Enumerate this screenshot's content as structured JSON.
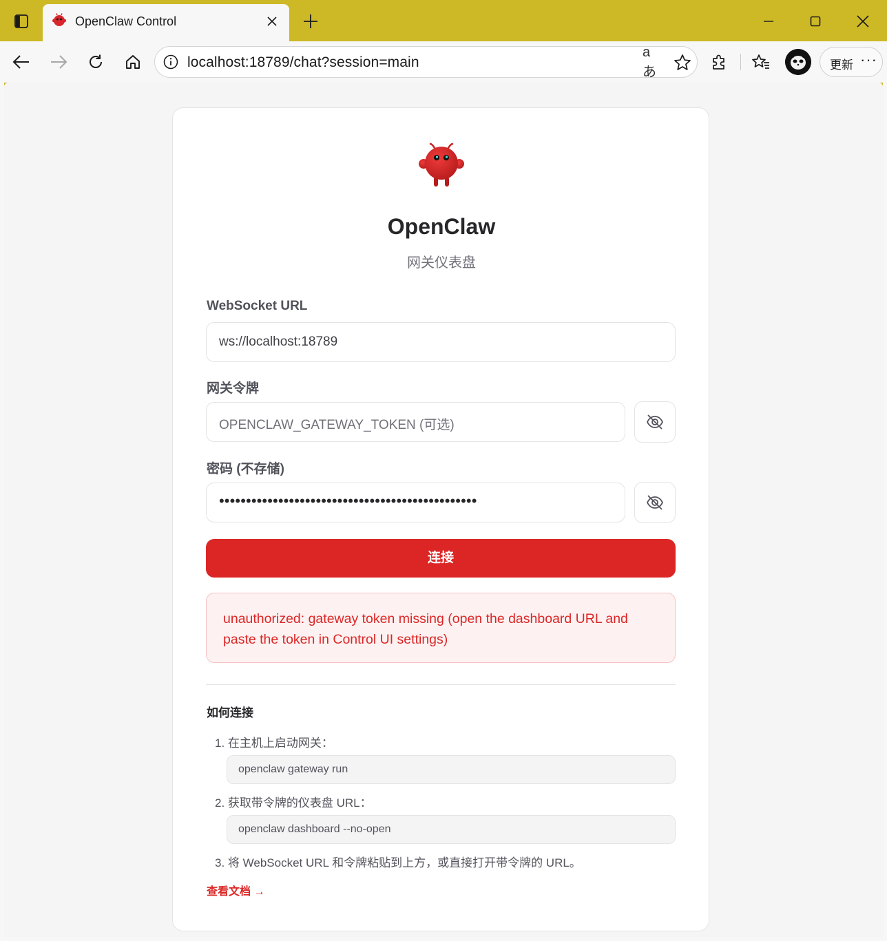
{
  "browser": {
    "tab": {
      "title": "OpenClaw Control",
      "favicon": "openclaw-mascot-icon"
    },
    "address_bar": {
      "url": "localhost:18789/chat?session=main",
      "read_aloud_glyph": "aあ"
    },
    "update_button": {
      "label": "更新",
      "more": "···"
    },
    "accent_color": "#cdb826"
  },
  "app": {
    "brand": "OpenClaw",
    "subtitle": "网关仪表盘",
    "websocket": {
      "label": "WebSocket URL",
      "value": "ws://localhost:18789"
    },
    "token": {
      "label": "网关令牌",
      "placeholder": "OPENCLAW_GATEWAY_TOKEN (可选)"
    },
    "password": {
      "label": "密码 (不存储)",
      "masked_value": "••••••••••••••••••••••••••••••••••••••••••••••••"
    },
    "connect_button": "连接",
    "error": "unauthorized: gateway token missing (open the dashboard URL and paste the token in Control UI settings)",
    "howto": {
      "title": "如何连接",
      "steps": [
        {
          "text": "1. 在主机上启动网关：",
          "code": "openclaw gateway run"
        },
        {
          "text": "2. 获取带令牌的仪表盘 URL：",
          "code": "openclaw dashboard --no-open"
        },
        {
          "text": "3. 将 WebSocket URL 和令牌粘贴到上方，或直接打开带令牌的 URL。"
        }
      ]
    },
    "docs_link": "查看文档 →",
    "colors": {
      "primary": "#dc2626",
      "error_bg": "#fdf1f1",
      "error_border": "#f7c3c3"
    }
  }
}
